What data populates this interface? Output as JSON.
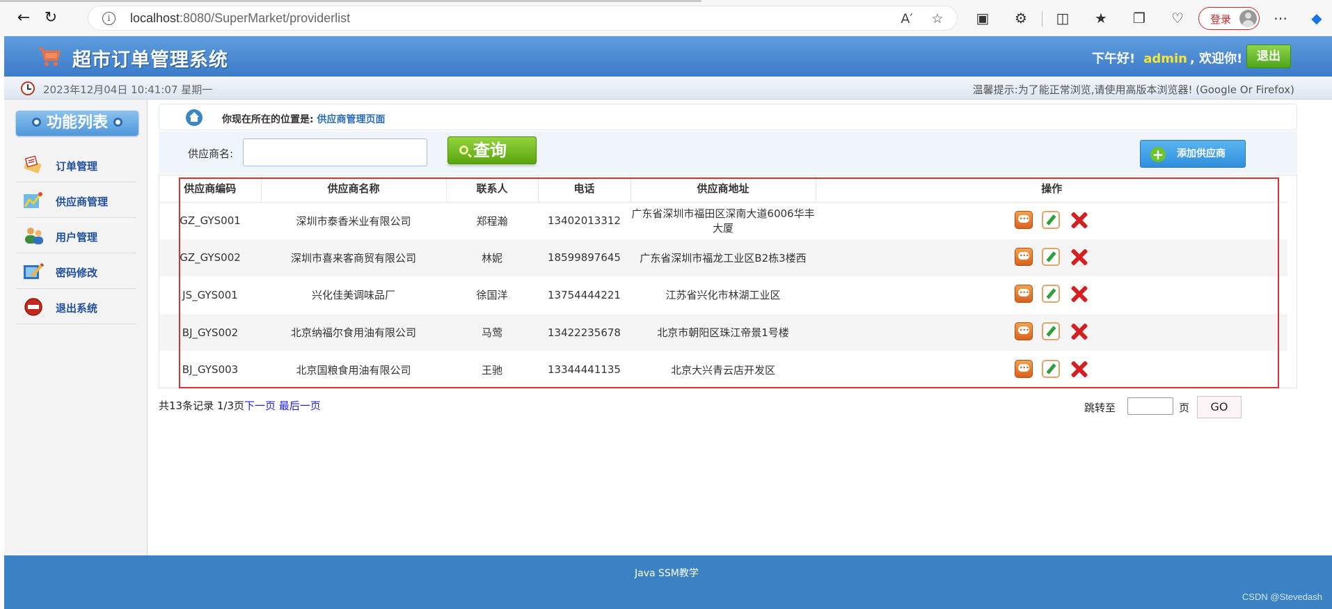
{
  "browser": {
    "url_host": "localhost",
    "url_rest": ":8080/SuperMarket/providerlist",
    "login_label": "登录"
  },
  "header": {
    "title": "超市订单管理系统",
    "greeting": "下午好!",
    "username": "admin",
    "welcome": ", 欢迎你!",
    "logout_label": "退出",
    "accent": "#f6e63a"
  },
  "timebar": {
    "datetime": "2023年12月04日 10:41:07 星期一",
    "tip": "温馨提示:为了能正常浏览,请使用高版本浏览器! (Google Or Firefox)"
  },
  "sidebar": {
    "title": "功能列表",
    "items": [
      {
        "label": "订单管理",
        "icon": "order-icon"
      },
      {
        "label": "供应商管理",
        "icon": "provider-icon"
      },
      {
        "label": "用户管理",
        "icon": "users-icon"
      },
      {
        "label": "密码修改",
        "icon": "password-icon"
      },
      {
        "label": "退出系统",
        "icon": "exit-icon"
      }
    ]
  },
  "breadcrumb": {
    "prefix": "你现在所在的位置是:",
    "current": "供应商管理页面"
  },
  "search": {
    "label": "供应商名:",
    "value": "",
    "query_label": "查询",
    "add_label": "添加供应商"
  },
  "table": {
    "columns": [
      "供应商编码",
      "供应商名称",
      "联系人",
      "电话",
      "供应商地址",
      "操作"
    ],
    "rows": [
      [
        "GZ_GYS001",
        "深圳市泰香米业有限公司",
        "郑程瀚",
        "13402013312",
        "广东省深圳市福田区深南大道6006华丰大厦"
      ],
      [
        "GZ_GYS002",
        "深圳市喜来客商贸有限公司",
        "林妮",
        "18599897645",
        "广东省深圳市福龙工业区B2栋3楼西"
      ],
      [
        "JS_GYS001",
        "兴化佳美调味品厂",
        "徐国洋",
        "13754444221",
        "江苏省兴化市林湖工业区"
      ],
      [
        "BJ_GYS002",
        "北京纳福尔食用油有限公司",
        "马莺",
        "13422235678",
        "北京市朝阳区珠江帝景1号楼"
      ],
      [
        "BJ_GYS003",
        "北京国粮食用油有限公司",
        "王驰",
        "13344441135",
        "北京大兴青云店开发区"
      ]
    ]
  },
  "pager": {
    "summary": "共13条记录 1/3页",
    "next_label": "下一页",
    "last_label": "最后一页",
    "jump_label": "跳转至",
    "page_unit": "页",
    "go_label": "GO"
  },
  "footer": {
    "text": "Java SSM教学",
    "watermark": "CSDN @Stevedash"
  }
}
